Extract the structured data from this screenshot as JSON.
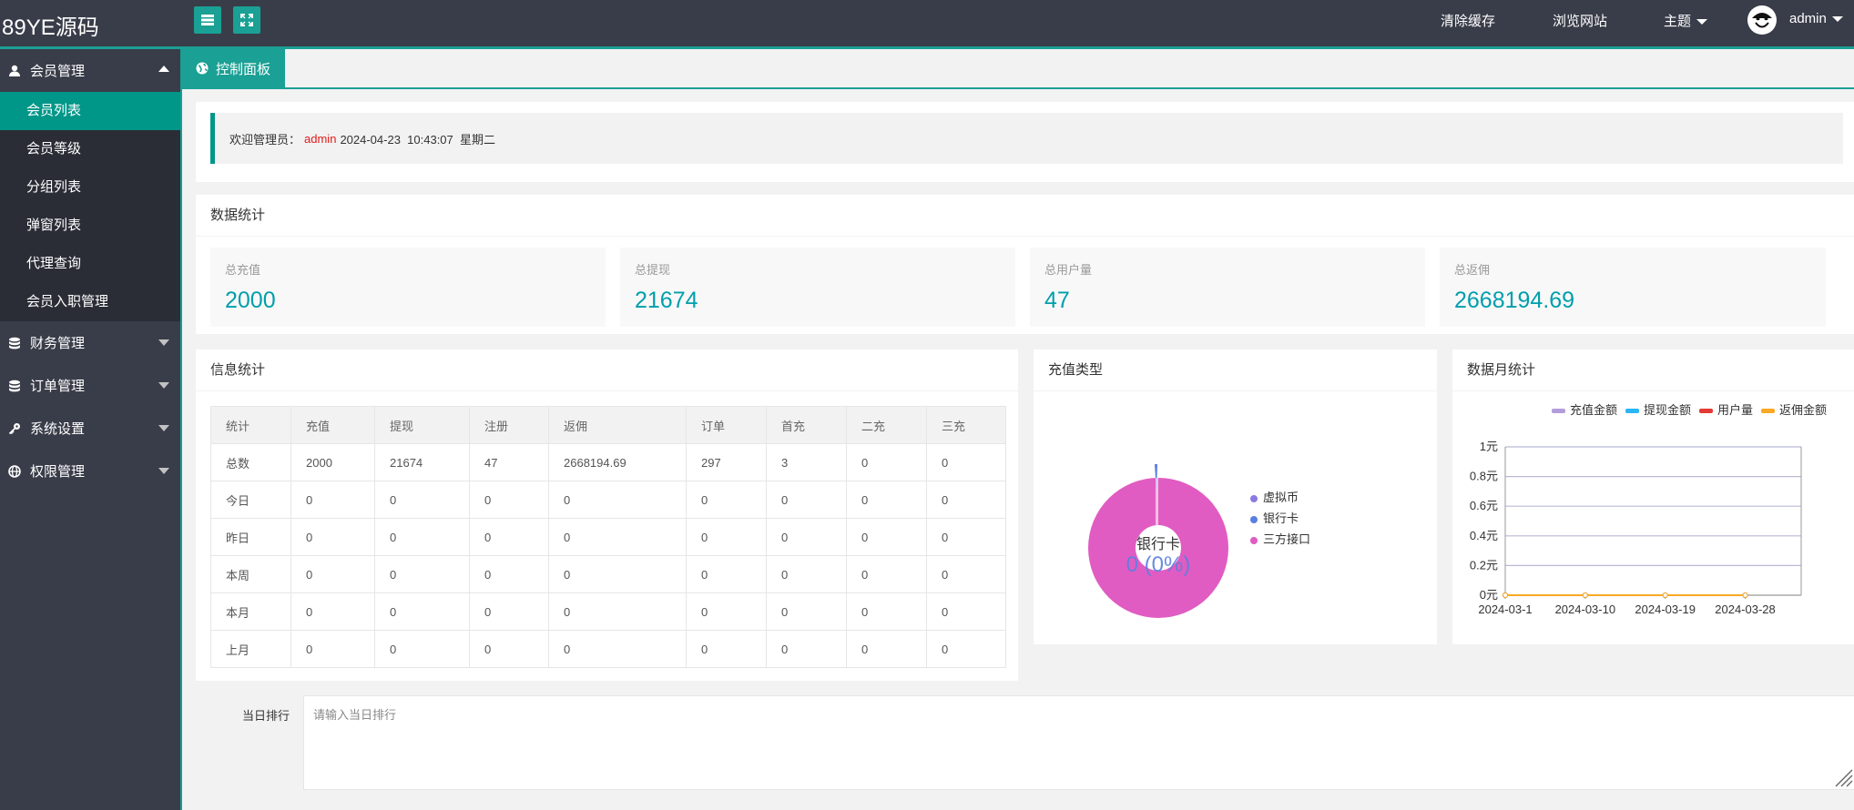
{
  "header": {
    "logo": "89YE源码",
    "links": {
      "clear_cache": "清除缓存",
      "browse_site": "浏览网站",
      "theme": "主题",
      "user": "admin"
    }
  },
  "sidebar": {
    "groups": [
      {
        "label": "会员管理",
        "icon": "user-icon",
        "expanded": true,
        "items": [
          "会员列表",
          "会员等级",
          "分组列表",
          "弹窗列表",
          "代理查询",
          "会员入职管理"
        ]
      },
      {
        "label": "财务管理",
        "icon": "database-icon"
      },
      {
        "label": "订单管理",
        "icon": "database-icon"
      },
      {
        "label": "系统设置",
        "icon": "key-icon"
      },
      {
        "label": "权限管理",
        "icon": "globe-icon"
      }
    ],
    "active_item": "会员列表"
  },
  "tab": {
    "label": "控制面板",
    "icon": "globe-icon"
  },
  "welcome": {
    "prefix": "欢迎管理员：",
    "user": "admin",
    "datetime": "2024-04-23  10:43:07  星期二"
  },
  "data_stats": {
    "title": "数据统计",
    "cards": [
      {
        "label": "总充值",
        "value": "2000"
      },
      {
        "label": "总提现",
        "value": "21674"
      },
      {
        "label": "总用户量",
        "value": "47"
      },
      {
        "label": "总返佣",
        "value": "2668194.69"
      }
    ]
  },
  "info_stats": {
    "title": "信息统计",
    "headers": [
      "统计",
      "充值",
      "提现",
      "注册",
      "返佣",
      "订单",
      "首充",
      "二充",
      "三充"
    ],
    "rows": [
      [
        "总数",
        "2000",
        "21674",
        "47",
        "2668194.69",
        "297",
        "3",
        "0",
        "0"
      ],
      [
        "今日",
        "0",
        "0",
        "0",
        "0",
        "0",
        "0",
        "0",
        "0"
      ],
      [
        "昨日",
        "0",
        "0",
        "0",
        "0",
        "0",
        "0",
        "0",
        "0"
      ],
      [
        "本周",
        "0",
        "0",
        "0",
        "0",
        "0",
        "0",
        "0",
        "0"
      ],
      [
        "本月",
        "0",
        "0",
        "0",
        "0",
        "0",
        "0",
        "0",
        "0"
      ],
      [
        "上月",
        "0",
        "0",
        "0",
        "0",
        "0",
        "0",
        "0",
        "0"
      ]
    ]
  },
  "recharge_type": {
    "title": "充值类型",
    "center_label": "银行卡",
    "center_value": "0 (0%)",
    "legend": [
      {
        "name": "虚拟币",
        "color": "#8b7ae0"
      },
      {
        "name": "银行卡",
        "color": "#5b7fe0"
      },
      {
        "name": "三方接口",
        "color": "#e05cc2"
      }
    ]
  },
  "monthly_stats": {
    "title": "数据月统计"
  },
  "chart_data": [
    {
      "type": "pie",
      "labels": [
        "虚拟币",
        "银行卡",
        "三方接口"
      ],
      "values": [
        0,
        0,
        100
      ],
      "colors": [
        "#8b7ae0",
        "#5b7fe0",
        "#e05cc2"
      ],
      "title": "充值类型"
    },
    {
      "type": "line",
      "title": "数据月统计",
      "x": [
        "2024-03-1",
        "2024-03-10",
        "2024-03-19",
        "2024-03-28"
      ],
      "series": [
        {
          "name": "充值金额",
          "values": [
            0,
            0,
            0,
            0
          ],
          "color": "#b39ddb"
        },
        {
          "name": "提现金额",
          "values": [
            0,
            0,
            0,
            0
          ],
          "color": "#29b6f6"
        },
        {
          "name": "用户量",
          "values": [
            0,
            0,
            0,
            0
          ],
          "color": "#e53935"
        },
        {
          "name": "返佣金额",
          "values": [
            0,
            0,
            0,
            0
          ],
          "color": "#f9a825"
        }
      ],
      "yticks": [
        "0元",
        "0.2元",
        "0.4元",
        "0.6元",
        "0.8元",
        "1元"
      ],
      "ylim": [
        0,
        1
      ],
      "grid": true,
      "legend_position": "top"
    }
  ],
  "rank": {
    "label": "当日排行",
    "placeholder": "请输入当日排行"
  }
}
